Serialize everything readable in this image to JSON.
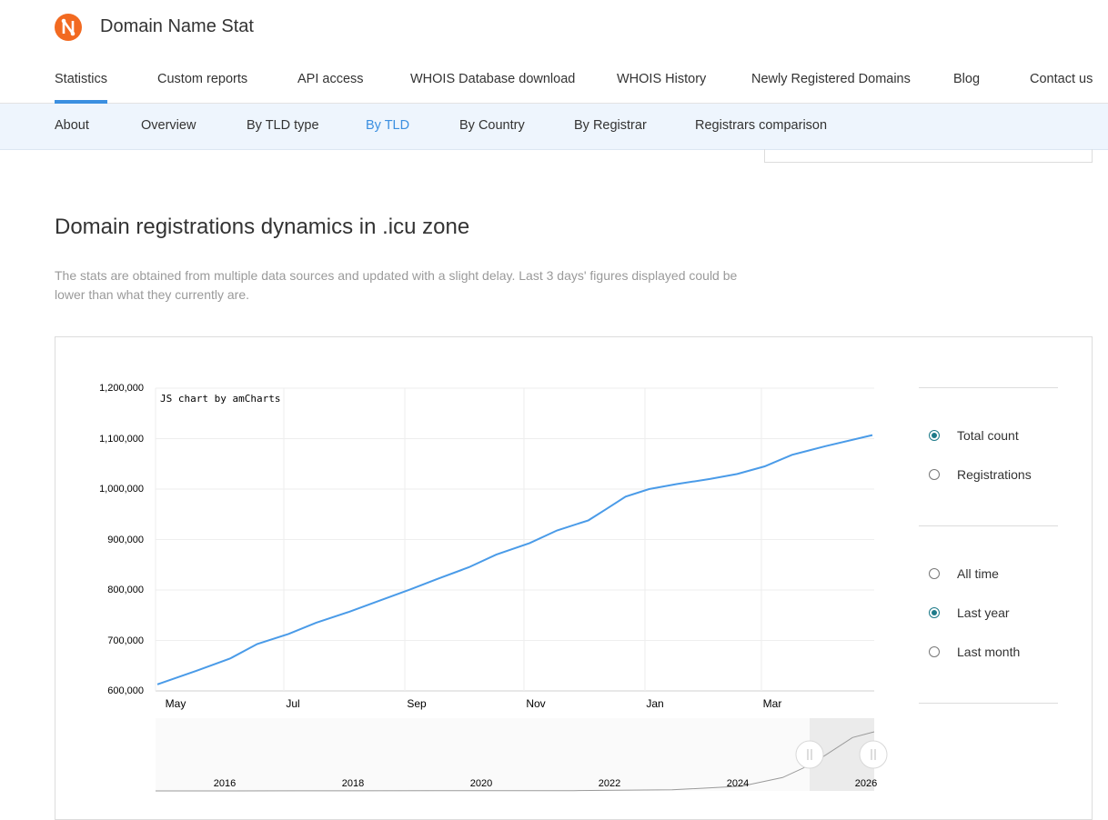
{
  "brand": {
    "name": "Domain Name Stat",
    "logo_color": "#f26a21"
  },
  "main_nav": [
    {
      "label": "Statistics",
      "active": true
    },
    {
      "label": "Custom reports"
    },
    {
      "label": "API access"
    },
    {
      "label": "WHOIS Database download"
    },
    {
      "label": "WHOIS History"
    },
    {
      "label": "Newly Registered Domains"
    },
    {
      "label": "Blog"
    },
    {
      "label": "Contact us"
    }
  ],
  "sub_nav": [
    {
      "label": "About"
    },
    {
      "label": "Overview"
    },
    {
      "label": "By TLD type"
    },
    {
      "label": "By TLD",
      "active": true
    },
    {
      "label": "By Country"
    },
    {
      "label": "By Registrar"
    },
    {
      "label": "Registrars comparison"
    }
  ],
  "page": {
    "title": "Domain registrations dynamics in .icu zone",
    "note": "The stats are obtained from multiple data sources and updated with a slight delay. Last 3 days' figures displayed could be lower than what they currently are."
  },
  "chart_controls": {
    "metric": [
      {
        "label": "Total count",
        "checked": true
      },
      {
        "label": "Registrations",
        "checked": false
      }
    ],
    "period": [
      {
        "label": "All time",
        "checked": false
      },
      {
        "label": "Last year",
        "checked": true
      },
      {
        "label": "Last month",
        "checked": false
      }
    ]
  },
  "colors": {
    "accent": "#3b8fe0",
    "line": "#4a9be8",
    "radio": "#1d7a89"
  },
  "chart_data": {
    "type": "line",
    "credit": "JS chart by amCharts",
    "y_ticks": [
      "1,200,000",
      "1,100,000",
      "1,000,000",
      "900,000",
      "800,000",
      "700,000",
      "600,000"
    ],
    "ylim": [
      600000,
      1200000
    ],
    "x_ticks": [
      "May",
      "Jul",
      "Sep",
      "Nov",
      "Jan",
      "Mar"
    ],
    "navigator_ticks": [
      "2016",
      "2018",
      "2020",
      "2022",
      "2024",
      "2026"
    ],
    "grid": true,
    "series": [
      {
        "x": [
          "2024-04-25",
          "2024-05-15",
          "2024-06-01",
          "2024-06-15",
          "2024-07-01",
          "2024-07-15",
          "2024-08-01",
          "2024-08-15",
          "2024-09-01",
          "2024-09-15",
          "2024-10-01",
          "2024-10-15",
          "2024-11-01",
          "2024-11-15",
          "2024-12-01",
          "2024-12-10",
          "2024-12-20",
          "2025-01-01",
          "2025-01-15",
          "2025-02-01",
          "2025-02-15",
          "2025-03-01",
          "2025-03-15",
          "2025-04-01",
          "2025-04-25"
        ],
        "y": [
          613000,
          640000,
          664000,
          693000,
          713000,
          735000,
          757000,
          777000,
          801000,
          822000,
          845000,
          870000,
          893000,
          918000,
          938000,
          960000,
          985000,
          1000000,
          1010000,
          1020000,
          1030000,
          1045000,
          1068000,
          1085000,
          1107000
        ]
      }
    ],
    "navigator": {
      "x": [
        "2015-01-01",
        "2017-01-01",
        "2019-01-01",
        "2021-01-01",
        "2022-06-01",
        "2023-06-01",
        "2024-01-01",
        "2024-06-01",
        "2025-01-01",
        "2025-04-25"
      ],
      "y": [
        0,
        1000,
        3000,
        5000,
        20000,
        90000,
        250000,
        500000,
        1000000,
        1107000
      ]
    }
  }
}
